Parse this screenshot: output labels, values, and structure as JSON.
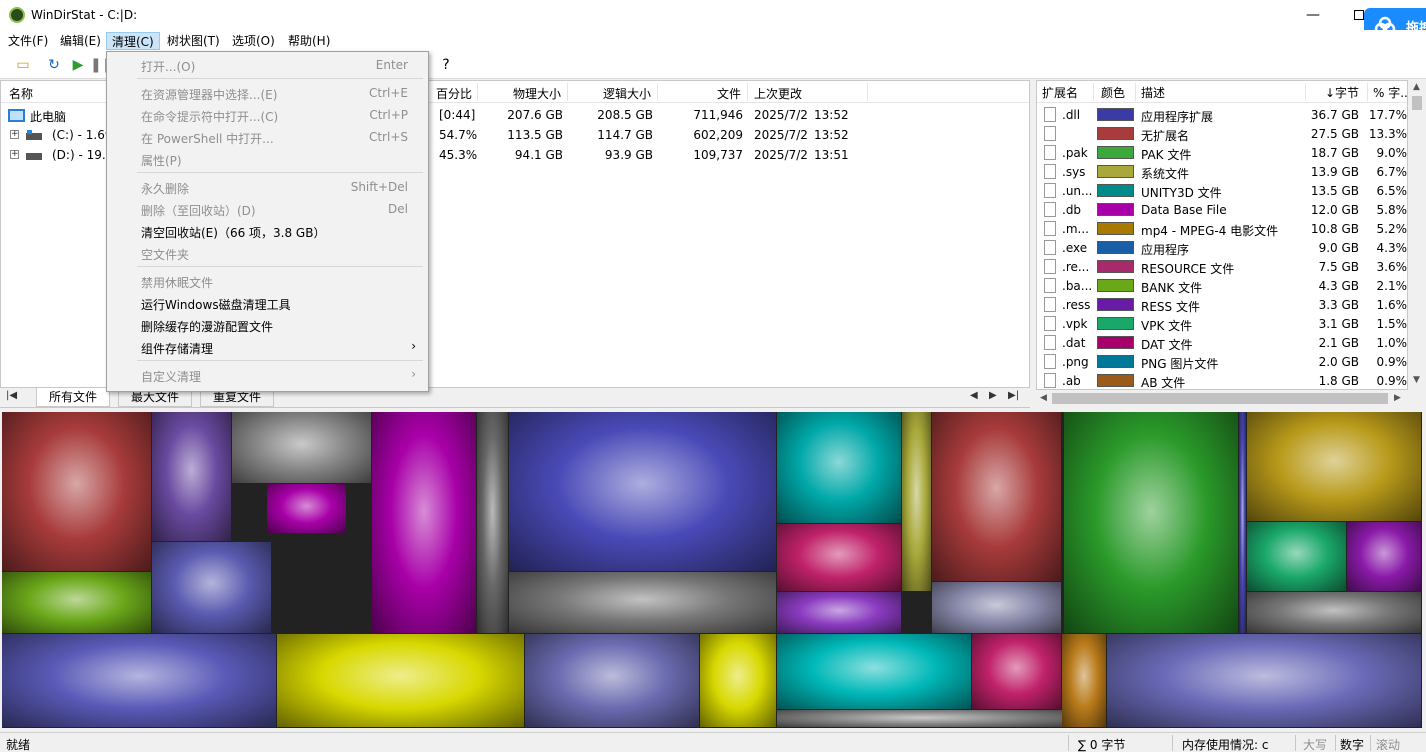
{
  "window": {
    "title": "WinDirStat - C:|D:",
    "minimize": "—",
    "cloud_label": "拖拽"
  },
  "menubar": [
    "文件(F)",
    "编辑(E)",
    "清理(C)",
    "树状图(T)",
    "选项(O)",
    "帮助(H)"
  ],
  "toolbar": {
    "help": "?"
  },
  "tree": {
    "headers": {
      "name": "名称",
      "percent": "百分比",
      "physical": "物理大小",
      "logical": "逻辑大小",
      "files": "文件",
      "modified": "上次更改"
    },
    "rows": [
      {
        "name": "此电脑",
        "percent": "[0:44]",
        "physical": "207.6 GB",
        "logical": "208.5 GB",
        "files": "711,946",
        "date": "2025/7/2",
        "time": "13:52"
      },
      {
        "name": "(C:) - 1.69",
        "percent": "54.7%",
        "physical": "113.5 GB",
        "logical": "114.7 GB",
        "files": "602,209",
        "date": "2025/7/2",
        "time": "13:52"
      },
      {
        "name": "(D:) - 19.9",
        "percent": "45.3%",
        "physical": "94.1 GB",
        "logical": "93.9 GB",
        "files": "109,737",
        "date": "2025/7/2",
        "time": "13:51"
      }
    ]
  },
  "tabs": [
    "所有文件",
    "最大文件",
    "重复文件"
  ],
  "extensions": {
    "headers": {
      "ext": "扩展名",
      "color": "颜色",
      "desc": "描述",
      "bytes": "↓字节",
      "pct": "% 字..."
    },
    "rows": [
      {
        "ext": ".dll",
        "color": "#3b3ba8",
        "desc": "应用程序扩展",
        "bytes": "36.7 GB",
        "pct": "17.7%"
      },
      {
        "ext": "",
        "color": "#a83b3b",
        "desc": "无扩展名",
        "bytes": "27.5 GB",
        "pct": "13.3%"
      },
      {
        "ext": ".pak",
        "color": "#3ba83b",
        "desc": "PAK 文件",
        "bytes": "18.7 GB",
        "pct": "9.0%"
      },
      {
        "ext": ".sys",
        "color": "#a8a83b",
        "desc": "系统文件",
        "bytes": "13.9 GB",
        "pct": "6.7%"
      },
      {
        "ext": ".un...",
        "color": "#008b8b",
        "desc": "UNITY3D 文件",
        "bytes": "13.5 GB",
        "pct": "6.5%"
      },
      {
        "ext": ".db",
        "color": "#a800a8",
        "desc": "Data Base File",
        "bytes": "12.0 GB",
        "pct": "5.8%"
      },
      {
        "ext": ".m...",
        "color": "#a87a00",
        "desc": "mp4 - MPEG-4 电影文件",
        "bytes": "10.8 GB",
        "pct": "5.2%"
      },
      {
        "ext": ".exe",
        "color": "#1a5ea8",
        "desc": "应用程序",
        "bytes": "9.0 GB",
        "pct": "4.3%"
      },
      {
        "ext": ".re...",
        "color": "#a82a6a",
        "desc": "RESOURCE 文件",
        "bytes": "7.5 GB",
        "pct": "3.6%"
      },
      {
        "ext": ".ba...",
        "color": "#6aa81a",
        "desc": "BANK 文件",
        "bytes": "4.3 GB",
        "pct": "2.1%"
      },
      {
        "ext": ".ress",
        "color": "#6a1aa8",
        "desc": "RESS 文件",
        "bytes": "3.3 GB",
        "pct": "1.6%"
      },
      {
        "ext": ".vpk",
        "color": "#1aa86a",
        "desc": "VPK 文件",
        "bytes": "3.1 GB",
        "pct": "1.5%"
      },
      {
        "ext": ".dat",
        "color": "#a8006a",
        "desc": "DAT 文件",
        "bytes": "2.1 GB",
        "pct": "1.0%"
      },
      {
        "ext": ".png",
        "color": "#00789a",
        "desc": "PNG 图片文件",
        "bytes": "2.0 GB",
        "pct": "0.9%"
      },
      {
        "ext": ".ab",
        "color": "#9a5a1a",
        "desc": "AB 文件",
        "bytes": "1.8 GB",
        "pct": "0.9%"
      }
    ]
  },
  "context_menu": [
    {
      "label": "打开...(O)",
      "shortcut": "Enter",
      "disabled": true
    },
    {
      "sep": true
    },
    {
      "label": "在资源管理器中选择...(E)",
      "shortcut": "Ctrl+E",
      "disabled": true
    },
    {
      "label": "在命令提示符中打开...(C)",
      "shortcut": "Ctrl+P",
      "disabled": true
    },
    {
      "label": "在 PowerShell 中打开...",
      "shortcut": "Ctrl+S",
      "disabled": true
    },
    {
      "label": "属性(P)",
      "shortcut": "",
      "disabled": true
    },
    {
      "sep": true
    },
    {
      "label": "永久删除",
      "shortcut": "Shift+Del",
      "disabled": true
    },
    {
      "label": "删除（至回收站）(D)",
      "shortcut": "Del",
      "disabled": true
    },
    {
      "label": "清空回收站(E)（66 项，3.8 GB）",
      "shortcut": "",
      "disabled": false
    },
    {
      "label": "空文件夹",
      "shortcut": "",
      "disabled": true
    },
    {
      "sep": true
    },
    {
      "label": "禁用休眠文件",
      "shortcut": "",
      "disabled": true
    },
    {
      "label": "运行Windows磁盘清理工具",
      "shortcut": "",
      "disabled": false
    },
    {
      "label": "删除缓存的漫游配置文件",
      "shortcut": "",
      "disabled": false
    },
    {
      "label": "组件存储清理",
      "shortcut": "",
      "disabled": false,
      "submenu": true
    },
    {
      "sep": true
    },
    {
      "label": "自定义清理",
      "shortcut": "",
      "disabled": true,
      "submenu": true
    }
  ],
  "statusbar": {
    "ready": "就绪",
    "sum": "∑ 0 字节",
    "memory": "内存使用情况: c",
    "caps": "大写",
    "num": "数字",
    "scroll": "滚动"
  }
}
